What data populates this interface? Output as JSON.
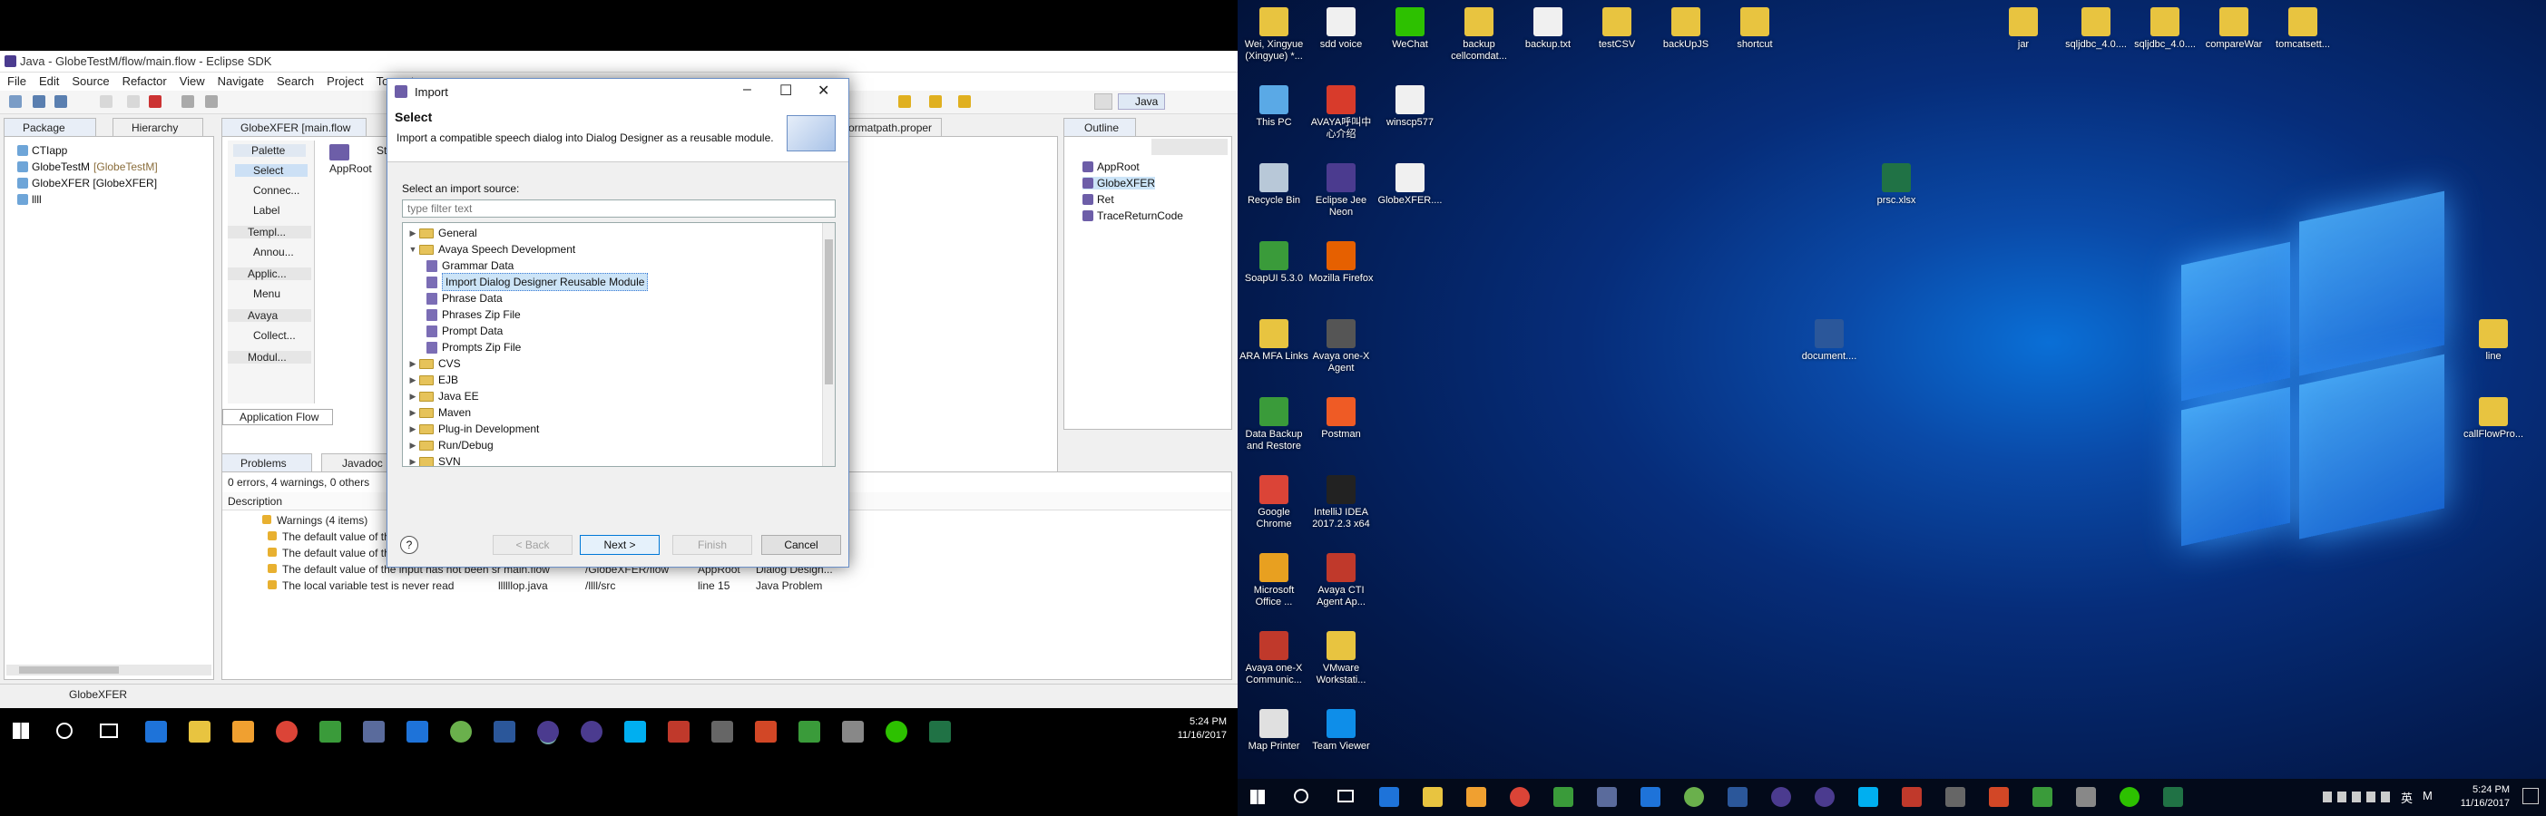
{
  "eclipse": {
    "title": "Java - GlobeTestM/flow/main.flow - Eclipse SDK",
    "menu": [
      "File",
      "Edit",
      "Source",
      "Refactor",
      "View",
      "Navigate",
      "Search",
      "Project",
      "Tomcat"
    ],
    "perspective": "Java",
    "package_tabs": [
      "Package",
      "Hierarchy"
    ],
    "editor_tab": "GlobeXFER [main.flow",
    "editor_tab2": "ormatpath.proper",
    "outline_tab": "Outline",
    "tree": [
      "CTIapp",
      "GlobeTestM",
      "[GlobeTestM]",
      "GlobeXFER [GlobeXFER]",
      "llll"
    ],
    "palette": {
      "title": "Palette",
      "items": [
        "Select",
        "Connec...",
        "Label",
        "Templ...",
        "Annou...",
        "Applic...",
        "Menu",
        "Avaya",
        "Collect...",
        "Modul..."
      ]
    },
    "canvas_node": "AppRoot",
    "canvas_node_suffix": "St",
    "app_flow_tab": "Application Flow",
    "outline_items": [
      "AppRoot",
      "GlobeXFER",
      "Ret",
      "TraceReturnCode"
    ],
    "problems": {
      "tab": "Problems",
      "javadoc_tab": "Javadoc",
      "summary": "0 errors, 4 warnings, 0 others",
      "col_desc": "Description",
      "group": "Warnings (4 items)",
      "rows": [
        "The default value of th",
        "The default value of th",
        "The default value of the input has not been sr main.flow",
        "The local variable test is never read"
      ],
      "row3_cols": [
        "/GlobeXFER/flow",
        "AppRoot",
        "Dialog Design..."
      ],
      "row4_cols": [
        "llllllop.java",
        "/llll/src",
        "line 15",
        "Java Problem"
      ]
    },
    "status": "GlobeXFER"
  },
  "dialog": {
    "title": "Import",
    "header": "Select",
    "description": "Import a compatible speech dialog into Dialog Designer as a reusable module.",
    "source_label": "Select an import source:",
    "filter_placeholder": "type filter text",
    "tree": [
      {
        "label": "General",
        "type": "folder",
        "level": 0,
        "expanded": false
      },
      {
        "label": "Avaya Speech Development",
        "type": "folder",
        "level": 0,
        "expanded": true
      },
      {
        "label": "Grammar Data",
        "type": "item",
        "level": 1
      },
      {
        "label": "Import Dialog Designer Reusable Module",
        "type": "item",
        "level": 1,
        "selected": true
      },
      {
        "label": "Phrase Data",
        "type": "item",
        "level": 1
      },
      {
        "label": "Phrases Zip File",
        "type": "item",
        "level": 1
      },
      {
        "label": "Prompt Data",
        "type": "item",
        "level": 1
      },
      {
        "label": "Prompts Zip File",
        "type": "item",
        "level": 1
      },
      {
        "label": "CVS",
        "type": "folder",
        "level": 0,
        "expanded": false
      },
      {
        "label": "EJB",
        "type": "folder",
        "level": 0,
        "expanded": false
      },
      {
        "label": "Java EE",
        "type": "folder",
        "level": 0,
        "expanded": false
      },
      {
        "label": "Maven",
        "type": "folder",
        "level": 0,
        "expanded": false
      },
      {
        "label": "Plug-in Development",
        "type": "folder",
        "level": 0,
        "expanded": false
      },
      {
        "label": "Run/Debug",
        "type": "folder",
        "level": 0,
        "expanded": false
      },
      {
        "label": "SVN",
        "type": "folder",
        "level": 0,
        "expanded": false
      }
    ],
    "buttons": {
      "back": "< Back",
      "next": "Next >",
      "finish": "Finish",
      "cancel": "Cancel"
    },
    "help": "?"
  },
  "taskbar1": {
    "time": "5:24 PM",
    "date": "11/16/2017"
  },
  "taskbar2": {
    "time": "5:24 PM",
    "date": "11/16/2017",
    "lang": "英",
    "ime": "M"
  },
  "desktop_icons": [
    {
      "label": "Wei, Xingyue (Xingyue) *...",
      "color": "#e8c440"
    },
    {
      "label": "sdd voice",
      "color": "#f0f0f0"
    },
    {
      "label": "WeChat",
      "color": "#2dc100"
    },
    {
      "label": "backup cellcomdat...",
      "color": "#e8c440"
    },
    {
      "label": "backup.txt",
      "color": "#f0f0f0"
    },
    {
      "label": "testCSV",
      "color": "#e8c440"
    },
    {
      "label": "backUpJS",
      "color": "#e8c440"
    },
    {
      "label": "shortcut",
      "color": "#e8c440"
    },
    {
      "label": "jar",
      "color": "#e8c440"
    },
    {
      "label": "sqljdbc_4.0....",
      "color": "#e8c440"
    },
    {
      "label": "sqljdbc_4.0....",
      "color": "#e8c440"
    },
    {
      "label": "compareWar",
      "color": "#e8c440"
    },
    {
      "label": "tomcatsett...",
      "color": "#e8c440"
    },
    {
      "label": "This PC",
      "color": "#5aa9e6"
    },
    {
      "label": "AVAYA呼叫中心介绍",
      "color": "#d83b2b"
    },
    {
      "label": "winscp577",
      "color": "#f0f0f0"
    },
    {
      "label": "Recycle Bin",
      "color": "#b8c8d8"
    },
    {
      "label": "Eclipse Jee Neon",
      "color": "#4b3b8f"
    },
    {
      "label": "GlobeXFER....",
      "color": "#f0f0f0"
    },
    {
      "label": "prsc.xlsx",
      "color": "#207245"
    },
    {
      "label": "SoapUI 5.3.0",
      "color": "#3a9b3a"
    },
    {
      "label": "Mozilla Firefox",
      "color": "#e66000"
    },
    {
      "label": "document....",
      "color": "#2b579a"
    },
    {
      "label": "line",
      "color": "#e8c440"
    },
    {
      "label": "ARA MFA Links",
      "color": "#e8c440"
    },
    {
      "label": "Avaya one-X Agent",
      "color": "#555"
    },
    {
      "label": "Data Backup and Restore",
      "color": "#3a9b3a"
    },
    {
      "label": "Postman",
      "color": "#ef5b25"
    },
    {
      "label": "callFlowPro...",
      "color": "#e8c440"
    },
    {
      "label": "Google Chrome",
      "color": "#db4437"
    },
    {
      "label": "IntelliJ IDEA 2017.2.3 x64",
      "color": "#222"
    },
    {
      "label": "Microsoft Office ...",
      "color": "#e8a020"
    },
    {
      "label": "Avaya CTI Agent Ap...",
      "color": "#c0392b"
    },
    {
      "label": "Avaya one-X Communic...",
      "color": "#c0392b"
    },
    {
      "label": "VMware Workstati...",
      "color": "#e8c440"
    },
    {
      "label": "Map Printer",
      "color": "#e0e0e0"
    },
    {
      "label": "Team Viewer",
      "color": "#0e8ee9"
    }
  ]
}
